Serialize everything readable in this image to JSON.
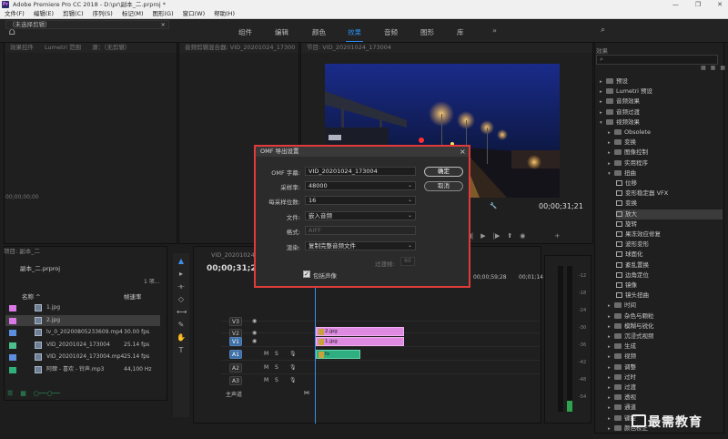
{
  "window": {
    "title": "Adobe Premiere Pro CC 2018 - D:\\pr\\副本_二.prproj *",
    "controls": [
      "—",
      "❐",
      "✕"
    ]
  },
  "menu": [
    "文件(F)",
    "编辑(E)",
    "剪辑(C)",
    "序列(S)",
    "标记(M)",
    "图形(G)",
    "窗口(W)",
    "帮助(H)"
  ],
  "workspace": {
    "tabs": [
      "组件",
      "编辑",
      "颜色",
      "效果",
      "音频",
      "图形",
      "库"
    ],
    "active": "效果",
    "more": "»",
    "accent": "#2d8ceb"
  },
  "source_panel": {
    "tabs": [
      "效果控件",
      "Lumetri 范围",
      "源：（无剪辑）",
      "音频剪辑混合器: VID_20201024_17300"
    ],
    "no_selection": "（未选择剪辑）",
    "timecode": "00;00;00;00"
  },
  "program_panel": {
    "tab": "节目: VID_20201024_173004",
    "timecode": "00;00;31;21"
  },
  "effects": {
    "tab": "效果",
    "tree": [
      {
        "label": "预设",
        "indent": 0,
        "expanded": false
      },
      {
        "label": "Lumetri 预设",
        "indent": 0,
        "expanded": false
      },
      {
        "label": "音频效果",
        "indent": 0,
        "expanded": false
      },
      {
        "label": "音频过渡",
        "indent": 0,
        "expanded": false
      },
      {
        "label": "视频效果",
        "indent": 0,
        "expanded": true
      },
      {
        "label": "Obsolete",
        "indent": 1,
        "expanded": false
      },
      {
        "label": "变换",
        "indent": 1,
        "expanded": false
      },
      {
        "label": "图像控制",
        "indent": 1,
        "expanded": false
      },
      {
        "label": "实用程序",
        "indent": 1,
        "expanded": false
      },
      {
        "label": "扭曲",
        "indent": 1,
        "expanded": true
      },
      {
        "label": "位移",
        "indent": 2,
        "effect": true
      },
      {
        "label": "变形稳定器 VFX",
        "indent": 2,
        "effect": true
      },
      {
        "label": "变换",
        "indent": 2,
        "effect": true
      },
      {
        "label": "放大",
        "indent": 2,
        "effect": true,
        "selected": true
      },
      {
        "label": "旋转",
        "indent": 2,
        "effect": true
      },
      {
        "label": "果冻效应修复",
        "indent": 2,
        "effect": true
      },
      {
        "label": "波形变形",
        "indent": 2,
        "effect": true
      },
      {
        "label": "球面化",
        "indent": 2,
        "effect": true
      },
      {
        "label": "紊乱置换",
        "indent": 2,
        "effect": true
      },
      {
        "label": "边角定位",
        "indent": 2,
        "effect": true
      },
      {
        "label": "镜像",
        "indent": 2,
        "effect": true
      },
      {
        "label": "镜头扭曲",
        "indent": 2,
        "effect": true
      },
      {
        "label": "时间",
        "indent": 1,
        "expanded": false
      },
      {
        "label": "杂色与颗粒",
        "indent": 1,
        "expanded": false
      },
      {
        "label": "模糊与锐化",
        "indent": 1,
        "expanded": false
      },
      {
        "label": "沉浸式视频",
        "indent": 1,
        "expanded": false
      },
      {
        "label": "生成",
        "indent": 1,
        "expanded": false
      },
      {
        "label": "视频",
        "indent": 1,
        "expanded": false
      },
      {
        "label": "调整",
        "indent": 1,
        "expanded": false
      },
      {
        "label": "过时",
        "indent": 1,
        "expanded": false
      },
      {
        "label": "过渡",
        "indent": 1,
        "expanded": false
      },
      {
        "label": "透视",
        "indent": 1,
        "expanded": false
      },
      {
        "label": "通道",
        "indent": 1,
        "expanded": false
      },
      {
        "label": "键控",
        "indent": 1,
        "expanded": false
      },
      {
        "label": "颜色校正",
        "indent": 1,
        "expanded": false
      }
    ]
  },
  "project": {
    "tab": "项目: 副本_二",
    "name": "副本_二.prproj",
    "count": "1 项...",
    "col_name": "名称 ^",
    "col_rate": "帧速率",
    "items": [
      {
        "name": "1.jpg",
        "rate": "",
        "color": "#d978e6"
      },
      {
        "name": "2.jpg",
        "rate": "",
        "color": "#d978e6"
      },
      {
        "name": "lv_0_20200805233609.mp4",
        "rate": "30.00 fps",
        "color": "#5c8fe0"
      },
      {
        "name": "VID_20201024_173004",
        "rate": "25.14 fps",
        "color": "#4cbf8b"
      },
      {
        "name": "VID_20201024_173004.mp4",
        "rate": "25.14 fps",
        "color": "#5c8fe0"
      },
      {
        "name": "阿肆 - 喜欢 - 铃声.mp3",
        "rate": "44,100 Hz",
        "color": "#2fb07a"
      }
    ]
  },
  "timeline": {
    "tab": "VID_20201024_173004",
    "timecode": "00;00;31;21",
    "ruler": [
      "00;00;59;28",
      "00;01;14"
    ],
    "tracks": [
      "V3",
      "V2",
      "V1",
      "A1",
      "A2",
      "A3"
    ],
    "master": "主声道",
    "clips": {
      "v2": "2.jpg",
      "v1": "1.jpg",
      "a1": "fx"
    }
  },
  "meter_ticks": [
    "-12",
    "-18",
    "-24",
    "-30",
    "-36",
    "-42",
    "-48",
    "-54"
  ],
  "dialog": {
    "title": "OMF 导出设置",
    "fields": [
      {
        "label": "OMF 字幕:",
        "value": "VID_20201024_173004",
        "dropdown": false,
        "disabled": false
      },
      {
        "label": "采样率:",
        "value": "48000",
        "dropdown": true,
        "disabled": false
      },
      {
        "label": "每采样位数:",
        "value": "16",
        "dropdown": true,
        "disabled": false
      },
      {
        "label": "文件:",
        "value": "嵌入音频",
        "dropdown": true,
        "disabled": false
      },
      {
        "label": "格式:",
        "value": "AIFF",
        "dropdown": false,
        "disabled": true
      },
      {
        "label": "渲染:",
        "value": "复制完整音频文件",
        "dropdown": true,
        "disabled": false
      }
    ],
    "handles_label": "过渡帧:",
    "handles_value": "60",
    "include_pan_label": "包括声像",
    "ok": "确定",
    "cancel": "取消"
  },
  "watermark": "最需教育",
  "colors": {
    "dialog_border": "#e03a3a",
    "clip_video": "#de8ae0",
    "clip_audio": "#2fae82",
    "playhead": "#3f8ee8"
  }
}
